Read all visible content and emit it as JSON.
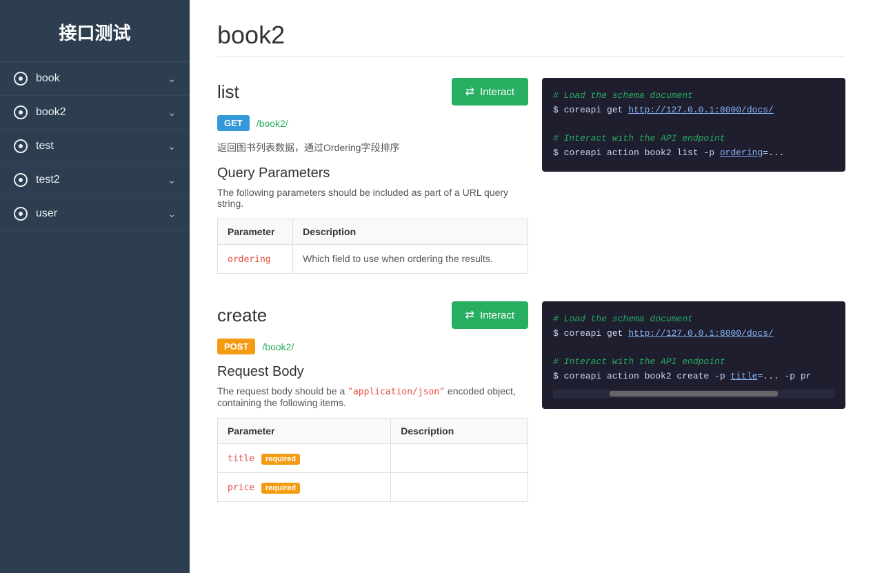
{
  "sidebar": {
    "title": "接口测试",
    "items": [
      {
        "id": "book",
        "label": "book"
      },
      {
        "id": "book2",
        "label": "book2"
      },
      {
        "id": "test",
        "label": "test"
      },
      {
        "id": "test2",
        "label": "test2"
      },
      {
        "id": "user",
        "label": "user"
      }
    ]
  },
  "page": {
    "title": "book2",
    "sections": [
      {
        "id": "list",
        "name": "list",
        "interact_label": "⇄ Interact",
        "method": "GET",
        "path": "/book2/",
        "description": "返回图书列表数据，通过Ordering字段排序",
        "params_heading": "Query Parameters",
        "params_desc": "The following parameters should be included as part of a URL query string.",
        "columns": [
          "Parameter",
          "Description"
        ],
        "rows": [
          {
            "name": "ordering",
            "required": false,
            "description": "Which field to use when ordering the results."
          }
        ],
        "code": {
          "line1_comment": "# Load the schema document",
          "line2": "$ coreapi get http://127.0.0.1:8000/docs/",
          "line3_comment": "# Interact with the API endpoint",
          "line4": "$ coreapi action book2 list -p ordering=..."
        }
      },
      {
        "id": "create",
        "name": "create",
        "interact_label": "⇄ Interact",
        "method": "POST",
        "path": "/book2/",
        "description_prefix": "The request body should be a ",
        "description_inline_code": "\"application/json\"",
        "description_suffix": " encoded object, containing the following items.",
        "params_heading": "Request Body",
        "columns": [
          "Parameter",
          "Description"
        ],
        "rows": [
          {
            "name": "title",
            "required": true,
            "description": ""
          },
          {
            "name": "price",
            "required": true,
            "description": ""
          }
        ],
        "code": {
          "line1_comment": "# Load the schema document",
          "line2": "$ coreapi get http://127.0.0.1:8000/docs/",
          "line3_comment": "# Interact with the API endpoint",
          "line4": "$ coreapi action book2 create -p title=... -p pr"
        }
      }
    ]
  },
  "labels": {
    "required": "required",
    "param_col": "Parameter",
    "desc_col": "Description"
  }
}
